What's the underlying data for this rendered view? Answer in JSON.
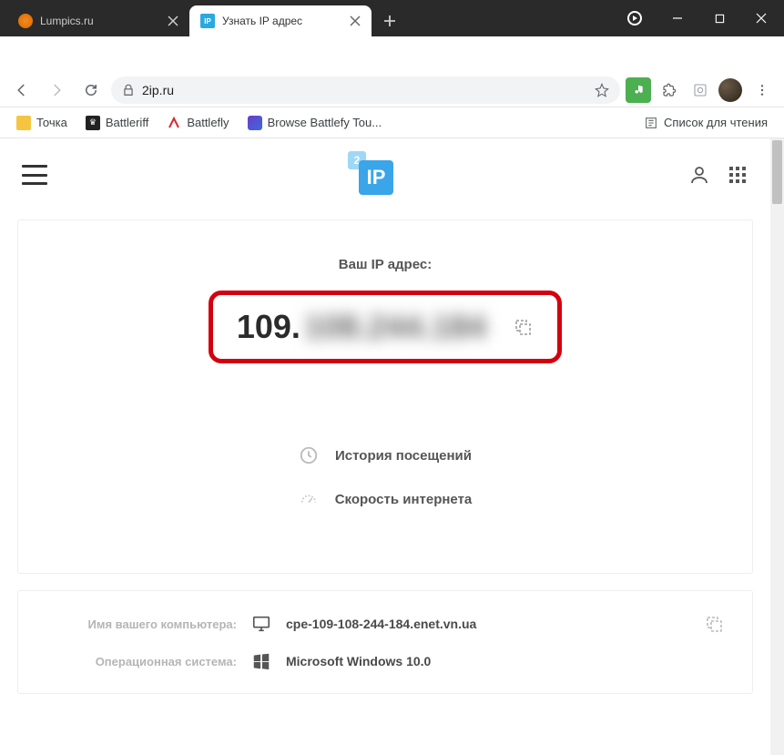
{
  "window": {
    "tabs": [
      {
        "title": "Lumpics.ru",
        "active": false,
        "favicon_color": "#f58a1f"
      },
      {
        "title": "Узнать IP адрес",
        "active": true,
        "favicon_bg": "#2aa9e0",
        "favicon_text": "IP"
      }
    ]
  },
  "addressbar": {
    "url": "2ip.ru"
  },
  "extensions": {
    "music_color": "#4caf50"
  },
  "bookmarks": {
    "items": [
      {
        "label": "Точка",
        "color": "#f5c542"
      },
      {
        "label": "Battleriff",
        "color": "#222"
      },
      {
        "label": "Battlefly",
        "color": "#e0262e"
      },
      {
        "label": "Browse Battlefy Tou...",
        "color": "#3a6bdc"
      }
    ],
    "reading_list": "Список для чтения"
  },
  "site": {
    "logo_small": "2",
    "logo_big": "IP"
  },
  "content": {
    "ip_label": "Ваш IP адрес:",
    "ip_visible": "109.",
    "ip_blurred": "108.244.184",
    "links": {
      "history": "История посещений",
      "speed": "Скорость интернета"
    },
    "info": {
      "hostname_label": "Имя вашего компьютера:",
      "hostname_value": "cpe-109-108-244-184.enet.vn.ua",
      "os_label": "Операционная система:",
      "os_value": "Microsoft Windows 10.0"
    }
  }
}
